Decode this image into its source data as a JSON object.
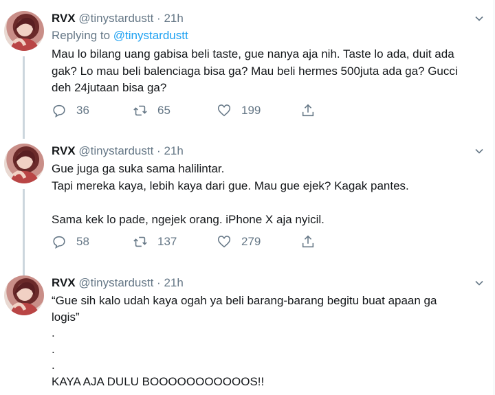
{
  "tweets": [
    {
      "name": "RVX",
      "handle": "@tinystardustt",
      "dot": "·",
      "time": "21h",
      "replying_prefix": "Replying to ",
      "replying_to": "@tinystardustt",
      "text": "Mau lo bilang uang gabisa beli taste, gue nanya aja nih. Taste lo ada, duit ada\ngak? Lo mau beli balenciaga bisa ga? Mau beli hermes 500juta ada ga? Gucci\ndeh 24jutaan bisa ga?",
      "replies": "36",
      "retweets": "65",
      "likes": "199"
    },
    {
      "name": "RVX",
      "handle": "@tinystardustt",
      "dot": "·",
      "time": "21h",
      "text": "Gue juga ga suka sama halilintar.\nTapi mereka kaya, lebih kaya dari gue. Mau gue ejek? Kagak pantes.\n\nSama kek lo pade, ngejek orang. iPhone X aja nyicil.",
      "replies": "58",
      "retweets": "137",
      "likes": "279"
    },
    {
      "name": "RVX",
      "handle": "@tinystardustt",
      "dot": "·",
      "time": "21h",
      "text": "“Gue sih kalo udah kaya ogah ya beli barang-barang begitu buat apaan ga\nlogis”\n.\n.\n.\nKAYA AJA DULU BOOOOOOOOOOOS!!"
    }
  ],
  "icons": {
    "reply": "comment-icon",
    "retweet": "retweet-icon",
    "like": "heart-icon",
    "share": "share-icon",
    "menu": "chevron-down-icon"
  },
  "colors": {
    "text": "#14171a",
    "muted": "#657786",
    "link": "#1da1f2",
    "thread": "#ccd6dd"
  }
}
